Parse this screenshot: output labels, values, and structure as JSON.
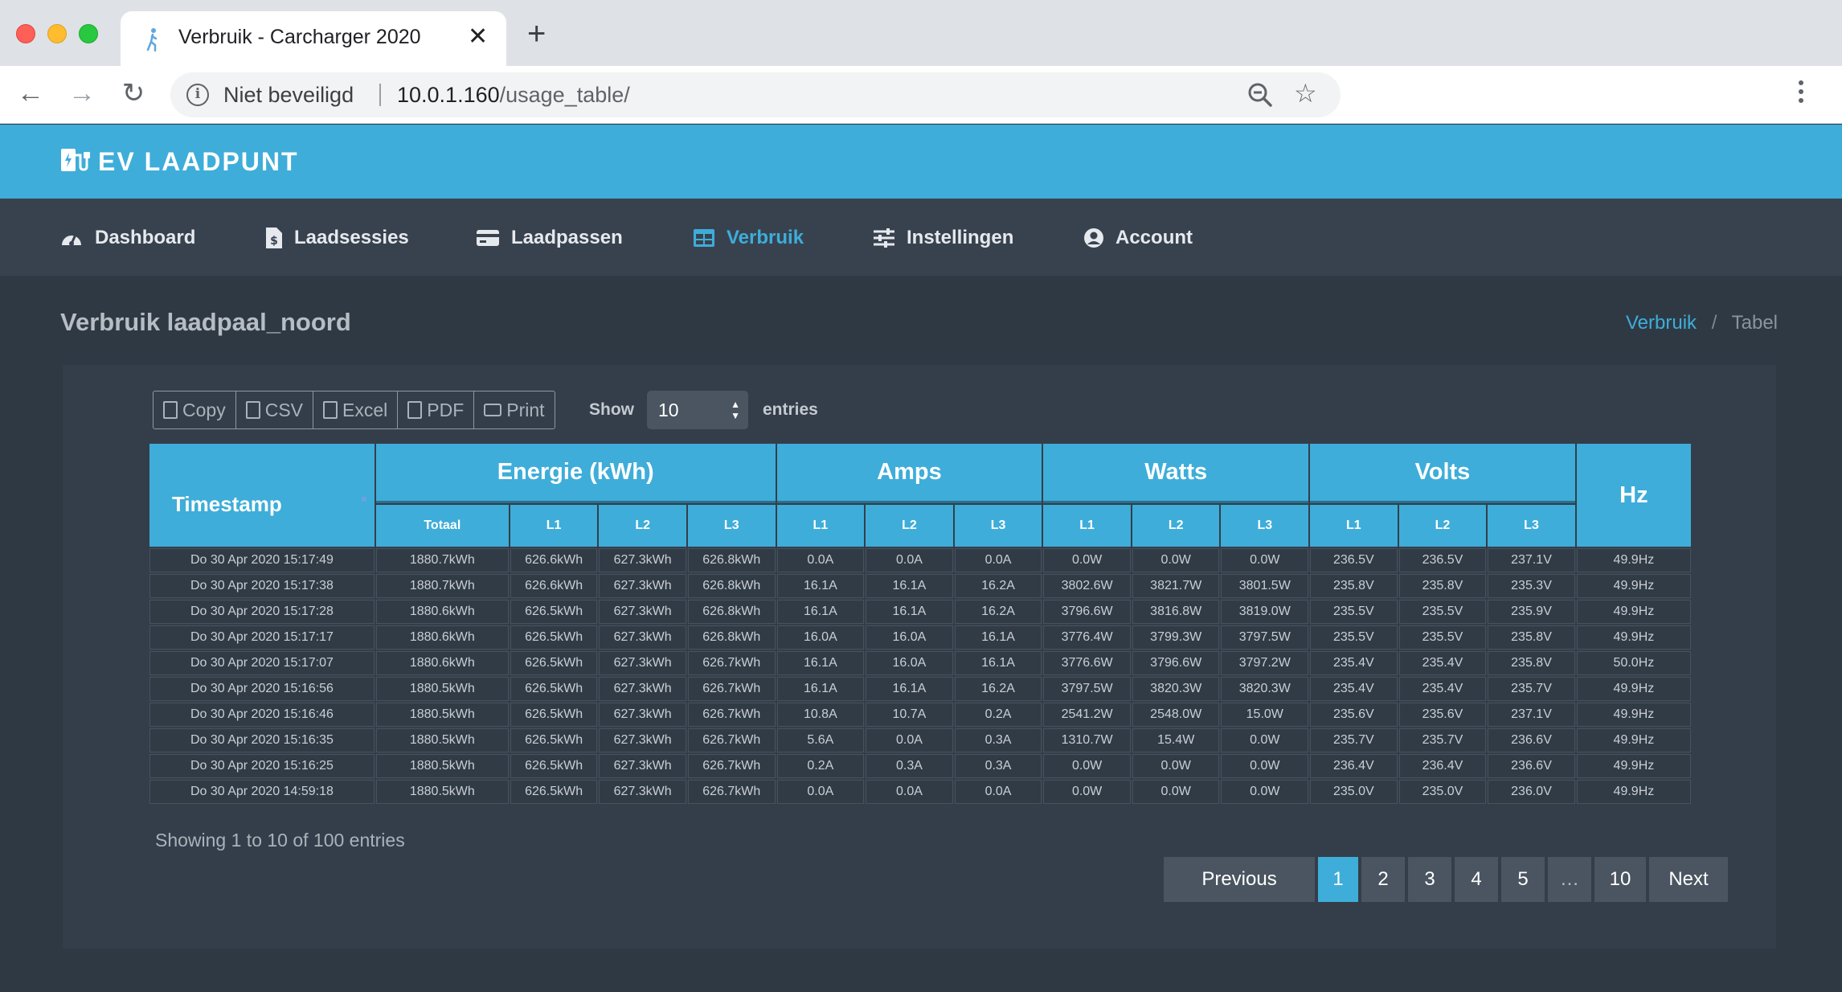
{
  "browser": {
    "tab_title": "Verbruik - Carcharger 2020",
    "security_label": "Niet beveiligd",
    "url_host": "10.0.1.160",
    "url_path": "/usage_table/"
  },
  "app": {
    "brand": "EV LAADPUNT",
    "nav": [
      "Dashboard",
      "Laadsessies",
      "Laadpassen",
      "Verbruik",
      "Instellingen",
      "Account"
    ],
    "active_nav": "Verbruik"
  },
  "page": {
    "title": "Verbruik laadpaal_noord",
    "breadcrumb": {
      "parent": "Verbruik",
      "separator": "/",
      "current": "Tabel"
    }
  },
  "toolbar": {
    "buttons": [
      "Copy",
      "CSV",
      "Excel",
      "PDF",
      "Print"
    ],
    "length_prefix": "Show",
    "length_value": "10",
    "length_suffix": "entries"
  },
  "table": {
    "groups": {
      "timestamp": "Timestamp",
      "energy": "Energie (kWh)",
      "amps": "Amps",
      "watts": "Watts",
      "volts": "Volts",
      "hz": "Hz"
    },
    "subheaders": {
      "energy": [
        "Totaal",
        "L1",
        "L2",
        "L3"
      ],
      "amps": [
        "L1",
        "L2",
        "L3"
      ],
      "watts": [
        "L1",
        "L2",
        "L3"
      ],
      "volts": [
        "L1",
        "L2",
        "L3"
      ]
    },
    "rows": [
      [
        "Do 30 Apr 2020 15:17:49",
        "1880.7kWh",
        "626.6kWh",
        "627.3kWh",
        "626.8kWh",
        "0.0A",
        "0.0A",
        "0.0A",
        "0.0W",
        "0.0W",
        "0.0W",
        "236.5V",
        "236.5V",
        "237.1V",
        "49.9Hz"
      ],
      [
        "Do 30 Apr 2020 15:17:38",
        "1880.7kWh",
        "626.6kWh",
        "627.3kWh",
        "626.8kWh",
        "16.1A",
        "16.1A",
        "16.2A",
        "3802.6W",
        "3821.7W",
        "3801.5W",
        "235.8V",
        "235.8V",
        "235.3V",
        "49.9Hz"
      ],
      [
        "Do 30 Apr 2020 15:17:28",
        "1880.6kWh",
        "626.5kWh",
        "627.3kWh",
        "626.8kWh",
        "16.1A",
        "16.1A",
        "16.2A",
        "3796.6W",
        "3816.8W",
        "3819.0W",
        "235.5V",
        "235.5V",
        "235.9V",
        "49.9Hz"
      ],
      [
        "Do 30 Apr 2020 15:17:17",
        "1880.6kWh",
        "626.5kWh",
        "627.3kWh",
        "626.8kWh",
        "16.0A",
        "16.0A",
        "16.1A",
        "3776.4W",
        "3799.3W",
        "3797.5W",
        "235.5V",
        "235.5V",
        "235.8V",
        "49.9Hz"
      ],
      [
        "Do 30 Apr 2020 15:17:07",
        "1880.6kWh",
        "626.5kWh",
        "627.3kWh",
        "626.7kWh",
        "16.1A",
        "16.0A",
        "16.1A",
        "3776.6W",
        "3796.6W",
        "3797.2W",
        "235.4V",
        "235.4V",
        "235.8V",
        "50.0Hz"
      ],
      [
        "Do 30 Apr 2020 15:16:56",
        "1880.5kWh",
        "626.5kWh",
        "627.3kWh",
        "626.7kWh",
        "16.1A",
        "16.1A",
        "16.2A",
        "3797.5W",
        "3820.3W",
        "3820.3W",
        "235.4V",
        "235.4V",
        "235.7V",
        "49.9Hz"
      ],
      [
        "Do 30 Apr 2020 15:16:46",
        "1880.5kWh",
        "626.5kWh",
        "627.3kWh",
        "626.7kWh",
        "10.8A",
        "10.7A",
        "0.2A",
        "2541.2W",
        "2548.0W",
        "15.0W",
        "235.6V",
        "235.6V",
        "237.1V",
        "49.9Hz"
      ],
      [
        "Do 30 Apr 2020 15:16:35",
        "1880.5kWh",
        "626.5kWh",
        "627.3kWh",
        "626.7kWh",
        "5.6A",
        "0.0A",
        "0.3A",
        "1310.7W",
        "15.4W",
        "0.0W",
        "235.7V",
        "235.7V",
        "236.6V",
        "49.9Hz"
      ],
      [
        "Do 30 Apr 2020 15:16:25",
        "1880.5kWh",
        "626.5kWh",
        "627.3kWh",
        "626.7kWh",
        "0.2A",
        "0.3A",
        "0.3A",
        "0.0W",
        "0.0W",
        "0.0W",
        "236.4V",
        "236.4V",
        "236.6V",
        "49.9Hz"
      ],
      [
        "Do 30 Apr 2020 14:59:18",
        "1880.5kWh",
        "626.5kWh",
        "627.3kWh",
        "626.7kWh",
        "0.0A",
        "0.0A",
        "0.0A",
        "0.0W",
        "0.0W",
        "0.0W",
        "235.0V",
        "235.0V",
        "236.0V",
        "49.9Hz"
      ]
    ]
  },
  "footer": {
    "info": "Showing 1 to 10 of 100 entries",
    "pagination": [
      "Previous",
      "1",
      "2",
      "3",
      "4",
      "5",
      "…",
      "10",
      "Next"
    ],
    "active_page": "1"
  },
  "colors": {
    "accent": "#3eadd9",
    "nav_bg": "#38424f",
    "page_bg": "#2f3944",
    "card_bg": "#343e4a"
  }
}
